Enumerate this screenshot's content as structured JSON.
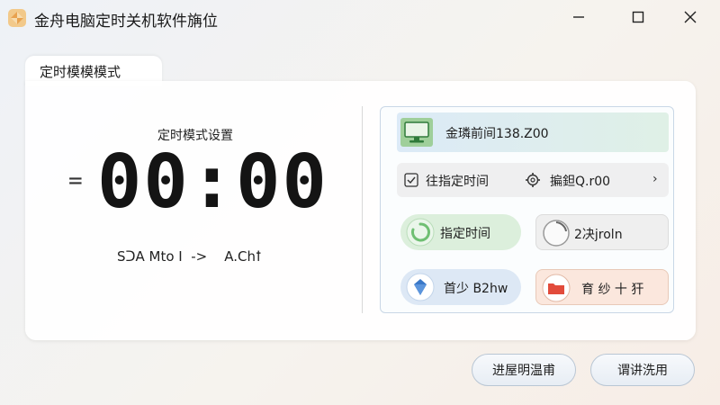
{
  "window": {
    "title": "金舟电脑定时关机软件㫋位"
  },
  "tab": {
    "label": "定时模模模式"
  },
  "left": {
    "mode_label": "定时模式设置",
    "dash": "=",
    "clock": "00:00",
    "sub_line": "SᑐA Mto I  ->    A.Chꝉ"
  },
  "right": {
    "status_label": "金璘前间138.Z00",
    "row2_left": "往指定时间",
    "row2_right": "揙鉭Q.r00",
    "chevron": "›",
    "pill_a": "指定时间",
    "pill_b": "2决jroln",
    "pill_c": "首少 B2hw",
    "pill_d": "育 纱 十 犴"
  },
  "buttons": {
    "primary": "进屋明温甫",
    "secondary": "谓讲洗用"
  },
  "colors": {
    "accent_green": "#6fbf73",
    "accent_blue": "#3a78c8",
    "accent_red": "#e24b3b"
  }
}
